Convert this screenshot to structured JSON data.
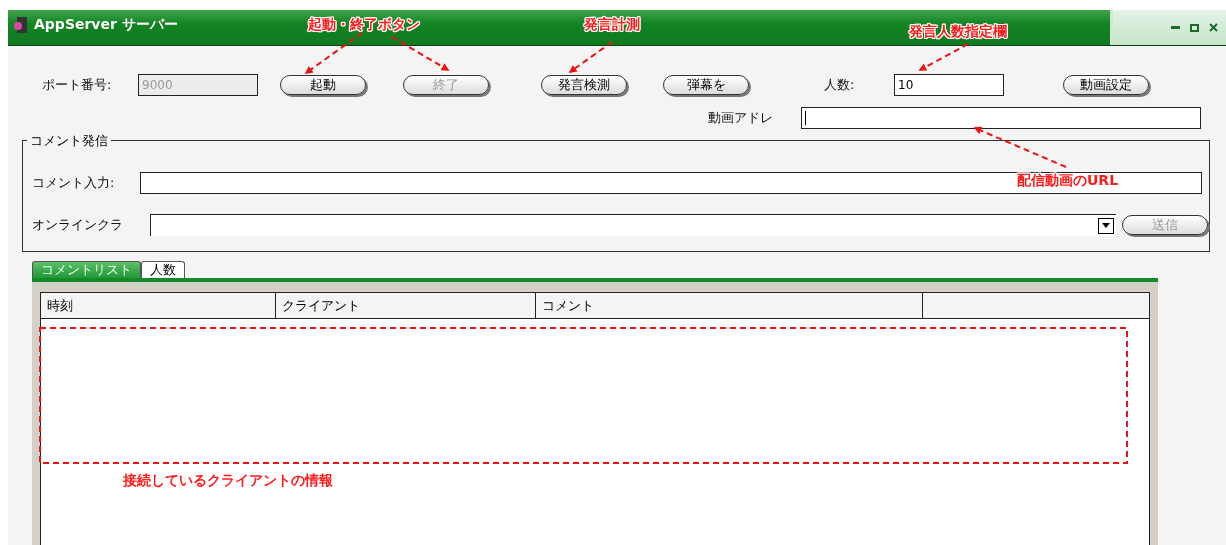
{
  "window": {
    "title": "AppServer サーバー"
  },
  "port": {
    "label": "ポート番号:",
    "value": "9000",
    "disabled": true
  },
  "buttons": [
    {
      "label": "起動",
      "disabled": false
    },
    {
      "label": "終了",
      "disabled": true
    },
    {
      "label": "発言検測",
      "disabled": false
    },
    {
      "label": "弾幕を",
      "disabled": false
    }
  ],
  "count": {
    "label": "人数:",
    "value": "10"
  },
  "video_settings_button": {
    "label": "動画設定",
    "disabled": false
  },
  "video_address": {
    "label": "動画アドレ"
  },
  "comment_group": {
    "title": "コメント発信",
    "comment_label": "コメント入力:",
    "client_label": "オンラインクラ",
    "send_button": {
      "label": "送信",
      "disabled": true
    }
  },
  "tabs": [
    {
      "label": "コメントリスト",
      "selected": true
    },
    {
      "label": "人数",
      "selected": false
    }
  ],
  "table": {
    "columns": [
      "時刻",
      "クライアント",
      "コメント"
    ]
  },
  "annotations": [
    {
      "text": "起動・終了ボタン"
    },
    {
      "text": "発言計測"
    },
    {
      "text": "発言人数指定欄"
    },
    {
      "text": "配信動画のURL"
    },
    {
      "text": "接続しているクライアントの情報"
    }
  ]
}
